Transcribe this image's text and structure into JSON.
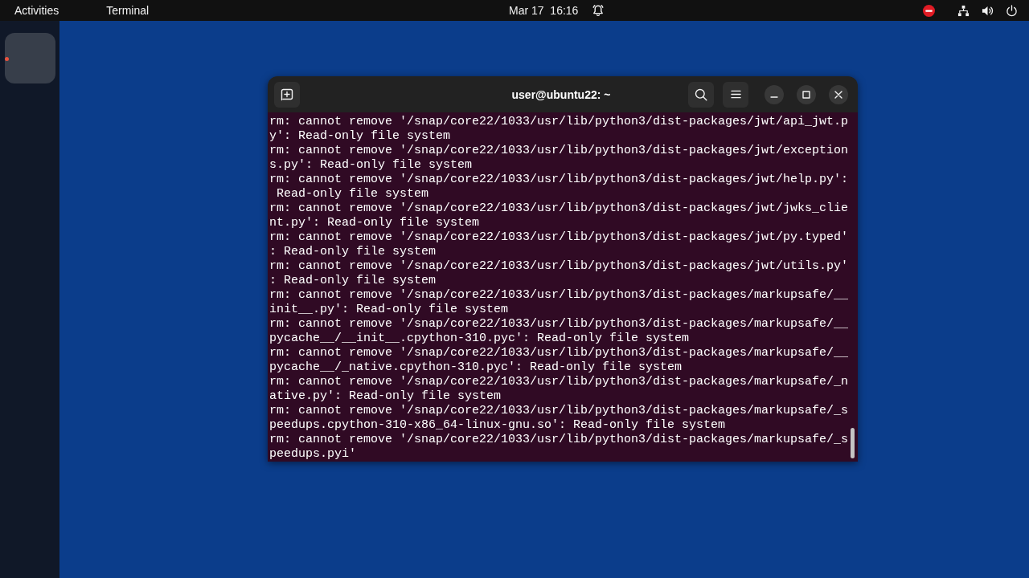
{
  "top_bar": {
    "activities": "Activities",
    "app_menu": "Terminal",
    "clock": "Mar 17  16:16"
  },
  "dock": {
    "apps": [
      {
        "running": true
      }
    ]
  },
  "window": {
    "title": "user@ubuntu22: ~",
    "lines": [
      "rm: cannot remove '/snap/core22/1033/usr/lib/python3/dist-packages/jwt/api_jwt.p",
      "y': Read-only file system",
      "rm: cannot remove '/snap/core22/1033/usr/lib/python3/dist-packages/jwt/exception",
      "s.py': Read-only file system",
      "rm: cannot remove '/snap/core22/1033/usr/lib/python3/dist-packages/jwt/help.py':",
      " Read-only file system",
      "rm: cannot remove '/snap/core22/1033/usr/lib/python3/dist-packages/jwt/jwks_clie",
      "nt.py': Read-only file system",
      "rm: cannot remove '/snap/core22/1033/usr/lib/python3/dist-packages/jwt/py.typed'",
      ": Read-only file system",
      "rm: cannot remove '/snap/core22/1033/usr/lib/python3/dist-packages/jwt/utils.py'",
      ": Read-only file system",
      "rm: cannot remove '/snap/core22/1033/usr/lib/python3/dist-packages/markupsafe/__",
      "init__.py': Read-only file system",
      "rm: cannot remove '/snap/core22/1033/usr/lib/python3/dist-packages/markupsafe/__",
      "pycache__/__init__.cpython-310.pyc': Read-only file system",
      "rm: cannot remove '/snap/core22/1033/usr/lib/python3/dist-packages/markupsafe/__",
      "pycache__/_native.cpython-310.pyc': Read-only file system",
      "rm: cannot remove '/snap/core22/1033/usr/lib/python3/dist-packages/markupsafe/_n",
      "ative.py': Read-only file system",
      "rm: cannot remove '/snap/core22/1033/usr/lib/python3/dist-packages/markupsafe/_s",
      "peedups.cpython-310-x86_64-linux-gnu.so': Read-only file system",
      "rm: cannot remove '/snap/core22/1033/usr/lib/python3/dist-packages/markupsafe/_s",
      "peedups.pyi'"
    ]
  }
}
